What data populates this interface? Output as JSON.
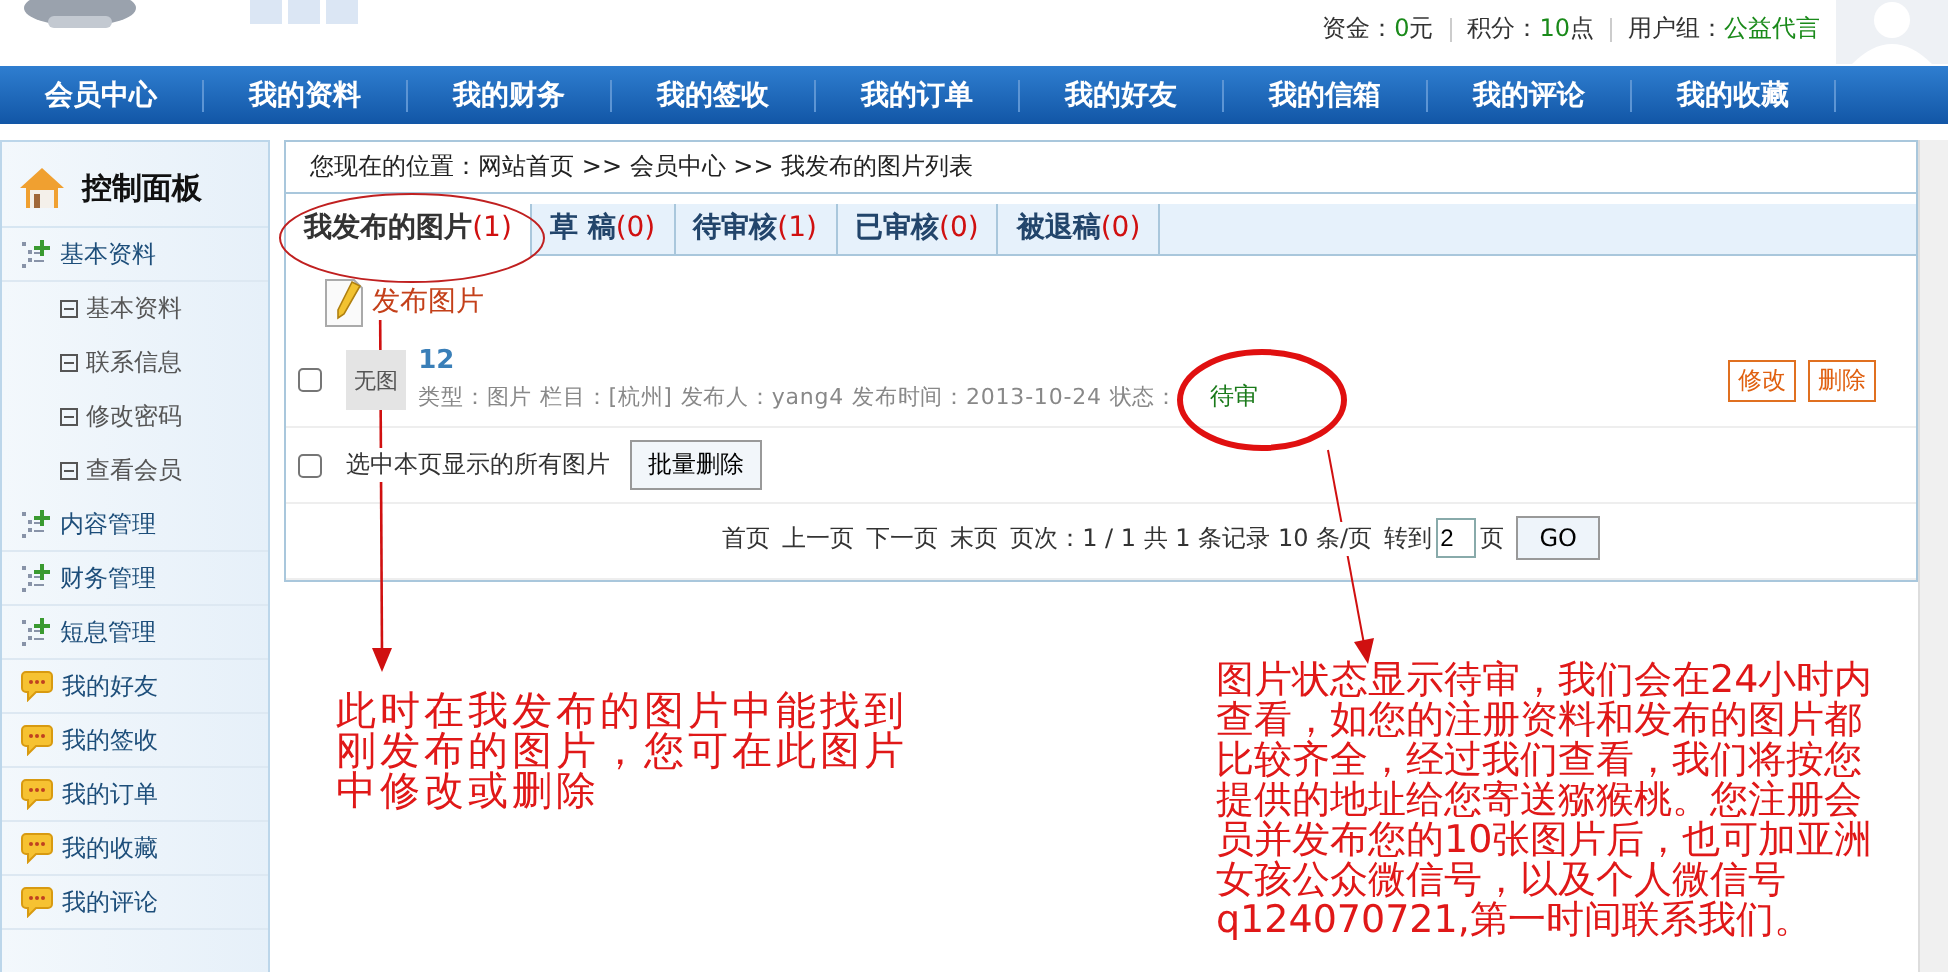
{
  "header": {
    "stats": [
      {
        "label": "资金：",
        "value": "0",
        "unit": "元"
      },
      {
        "label": "积分：",
        "value": "10",
        "unit": "点"
      },
      {
        "label": "用户组：",
        "value": "公益代言"
      }
    ]
  },
  "nav": [
    "会员中心",
    "我的资料",
    "我的财务",
    "我的签收",
    "我的订单",
    "我的好友",
    "我的信箱",
    "我的评论",
    "我的收藏"
  ],
  "sidebar": {
    "title": "控制面板",
    "items": [
      {
        "kind": "tree",
        "label": "基本资料",
        "children": [
          {
            "label": "基本资料"
          },
          {
            "label": "联系信息"
          },
          {
            "label": "修改密码"
          },
          {
            "label": "查看会员"
          }
        ]
      },
      {
        "kind": "tree",
        "label": "内容管理"
      },
      {
        "kind": "tree",
        "label": "财务管理"
      },
      {
        "kind": "tree",
        "label": "短息管理"
      },
      {
        "kind": "chat",
        "label": "我的好友"
      },
      {
        "kind": "chat",
        "label": "我的签收"
      },
      {
        "kind": "chat",
        "label": "我的订单"
      },
      {
        "kind": "chat",
        "label": "我的收藏"
      },
      {
        "kind": "chat",
        "label": "我的评论"
      }
    ]
  },
  "breadcrumb": "您现在的位置：网站首页 >> 会员中心 >> 我发布的图片列表",
  "tabs": [
    {
      "label": "我发布的图片",
      "count": "(1)",
      "selected": true
    },
    {
      "label": "草  稿",
      "count": "(0)",
      "selected": false
    },
    {
      "label": "待审核",
      "count": "(1)",
      "selected": false
    },
    {
      "label": "已审核",
      "count": "(0)",
      "selected": false
    },
    {
      "label": "被退稿",
      "count": "(0)",
      "selected": false
    }
  ],
  "publish_link": "发布图片",
  "items": [
    {
      "checked": false,
      "thumb": "无图",
      "title": "12",
      "meta": "类型：图片 栏目：[杭州] 发布人：yang4 发布时间：2013-10-24 状态：",
      "status": "待审",
      "actions": [
        "修改",
        "删除"
      ]
    }
  ],
  "select_all": {
    "checked": false,
    "label": "选中本页显示的所有图片",
    "button": "批量删除"
  },
  "pager": {
    "links": [
      "首页",
      "上一页",
      "下一页",
      "末页"
    ],
    "info": "页次：1 / 1 共 1 条记录 10 条/页",
    "goto_label": "转到",
    "goto_value": "2",
    "goto_suffix": "页",
    "go": "GO"
  },
  "annotations": [
    {
      "text": "此时在我发布的图片中能找到刚发布的图片，您可在此图片中修改或删除"
    },
    {
      "text": "图片状态显示待审，我们会在24小时内查看，如您的注册资料和发布的图片都比较齐全，经过我们查看，我们将按您提供的地址给您寄送猕猴桃。您注册会员并发布您的10张图片后，也可加亚洲女孩公众微信号，以及个人微信号q124070721,第一时间联系我们。"
    }
  ]
}
